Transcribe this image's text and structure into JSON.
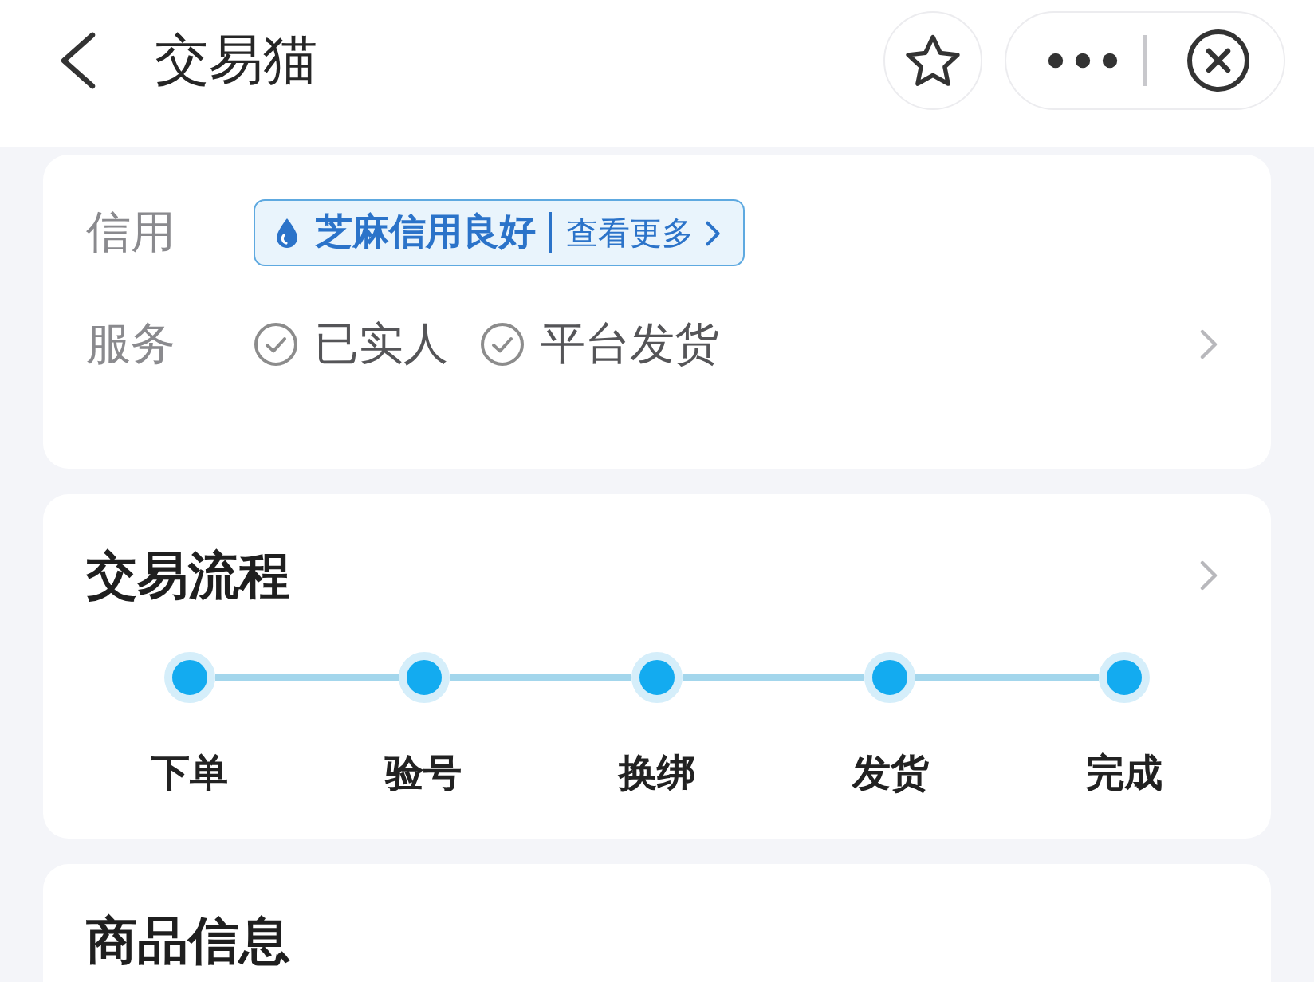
{
  "header": {
    "title": "交易猫"
  },
  "info_card": {
    "credit": {
      "label": "信用",
      "rating": "芝麻信用良好",
      "link": "查看更多"
    },
    "services": {
      "label": "服务",
      "items": [
        "已实人",
        "平台发货"
      ]
    }
  },
  "process_card": {
    "title": "交易流程",
    "steps": [
      "下单",
      "验号",
      "换绑",
      "发货",
      "完成"
    ]
  },
  "goods_card": {
    "title": "商品信息"
  }
}
